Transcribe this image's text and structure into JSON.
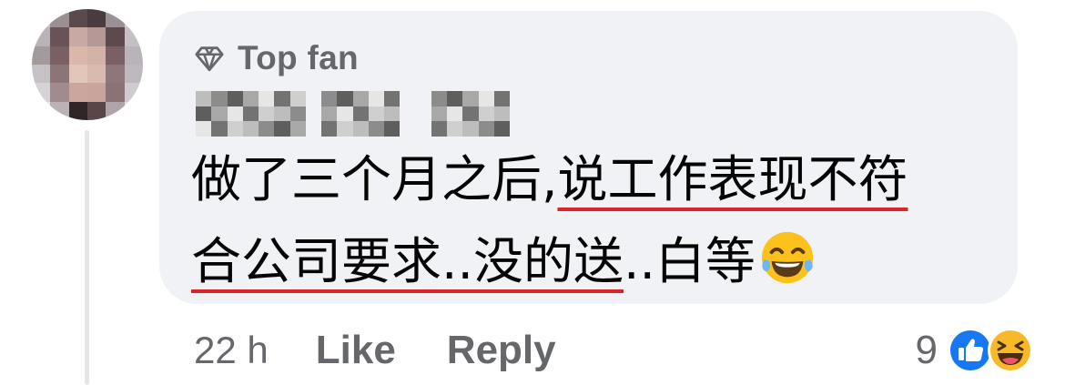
{
  "comment": {
    "badge": "Top fan",
    "text_line1_plain": "做了三个月之后,",
    "text_line1_underlined": "说工作表现不符",
    "text_line2_underlined": "合公司要求..没的送",
    "text_line2_plain": "..白等",
    "emoji": "laughing-tears-icon",
    "underline_color": "#d9262b"
  },
  "actions": {
    "time": "22 h",
    "like_label": "Like",
    "reply_label": "Reply"
  },
  "reactions": {
    "count": "9",
    "icons": [
      "like-reaction-icon",
      "haha-reaction-icon"
    ]
  },
  "colors": {
    "bubble": "#f0f2f5",
    "muted_text": "#65676b",
    "like_blue": "#1877f2",
    "haha_yellow": "#f7b928"
  }
}
